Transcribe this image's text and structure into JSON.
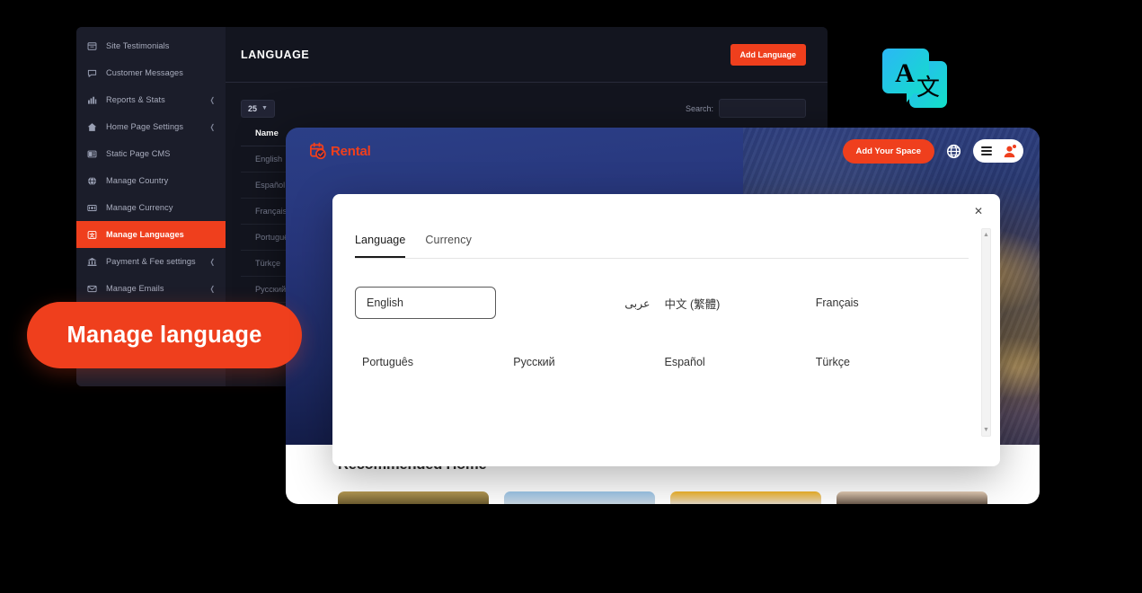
{
  "badge": {
    "label": "Manage language"
  },
  "admin": {
    "title": "LANGUAGE",
    "add_button": "Add Language",
    "page_length": "25",
    "search_label": "Search:",
    "search_value": "",
    "table": {
      "columns": [
        "Name"
      ],
      "rows": [
        "English",
        "Español",
        "Français",
        "Portuguê",
        "Türkçe",
        "Русский"
      ]
    },
    "sidebar": {
      "items": [
        {
          "label": "Site Testimonials",
          "icon": "testimonial-icon",
          "chevron": false,
          "active": false
        },
        {
          "label": "Customer Messages",
          "icon": "chat-icon",
          "chevron": false,
          "active": false
        },
        {
          "label": "Reports & Stats",
          "icon": "chart-icon",
          "chevron": true,
          "active": false
        },
        {
          "label": "Home Page Settings",
          "icon": "home-icon",
          "chevron": true,
          "active": false
        },
        {
          "label": "Static Page CMS",
          "icon": "page-icon",
          "chevron": false,
          "active": false
        },
        {
          "label": "Manage Country",
          "icon": "globe-icon",
          "chevron": false,
          "active": false
        },
        {
          "label": "Manage Currency",
          "icon": "currency-icon",
          "chevron": false,
          "active": false
        },
        {
          "label": "Manage Languages",
          "icon": "language-icon",
          "chevron": false,
          "active": true
        },
        {
          "label": "Payment & Fee settings",
          "icon": "bank-icon",
          "chevron": true,
          "active": false
        },
        {
          "label": "Manage Emails",
          "icon": "envelope-icon",
          "chevron": true,
          "active": false
        }
      ]
    }
  },
  "frontend": {
    "brand": "Rental",
    "add_space_button": "Add Your Space",
    "recommended_title": "Recommended Home"
  },
  "modal": {
    "close": "✕",
    "tabs": [
      {
        "label": "Language",
        "active": true
      },
      {
        "label": "Currency",
        "active": false
      }
    ],
    "languages": [
      {
        "label": "English",
        "selected": true,
        "rtl": false
      },
      {
        "label": "عربى",
        "selected": false,
        "rtl": true
      },
      {
        "label": "中文 (繁體)",
        "selected": false,
        "rtl": false
      },
      {
        "label": "Français",
        "selected": false,
        "rtl": false
      },
      {
        "label": "Português",
        "selected": false,
        "rtl": false
      },
      {
        "label": "Русский",
        "selected": false,
        "rtl": false
      },
      {
        "label": "Español",
        "selected": false,
        "rtl": false
      },
      {
        "label": "Türkçe",
        "selected": false,
        "rtl": false
      }
    ]
  },
  "colors": {
    "accent": "#ef3f1d",
    "admin_bg": "#13151f",
    "sidebar_bg": "#1b1d2a",
    "hero_blue": "#27357a",
    "page_bg": "#000000"
  }
}
